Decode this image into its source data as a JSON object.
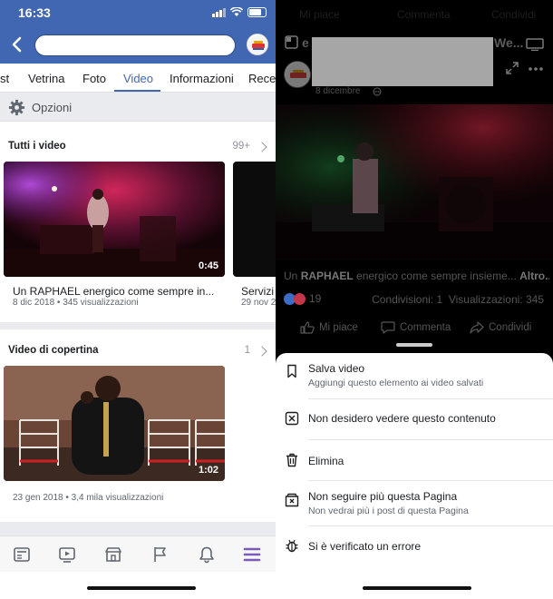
{
  "status_bar": {
    "time": "16:33"
  },
  "left": {
    "tabs": [
      "st",
      "Vetrina",
      "Foto",
      "Video",
      "Informazioni",
      "Recen"
    ],
    "active_tab": "Video",
    "options_label": "Opzioni",
    "section_all": {
      "title": "Tutti i video",
      "count": "99+"
    },
    "videos": [
      {
        "duration": "0:45",
        "title": "Un RAPHAEL energico come sempre in...",
        "meta": "8 dic 2018 • 345 visualizzazioni"
      },
      {
        "title": "Servizi",
        "meta": "29 nov 2"
      }
    ],
    "section_cover": {
      "title": "Video di copertina",
      "count": "1"
    },
    "cover_video": {
      "duration": "1:02",
      "meta": "23 gen 2018 • 3,4 mila visualizzazioni"
    },
    "bottom_nav_icons": [
      "news-feed-icon",
      "watch-icon",
      "marketplace-icon",
      "pages-icon",
      "notifications-icon",
      "menu-icon"
    ]
  },
  "right": {
    "top_actions": [
      "Mi piace",
      "Commenta",
      "Condividi"
    ],
    "page_name_prefix": "e",
    "page_name_suffix": "We...",
    "post_date": "8 dicembre",
    "caption_prefix": "Un ",
    "caption_bold": "RAPHAEL",
    "caption_rest": " energico come sempre insieme...",
    "caption_more": "Altro...",
    "reaction_count": "19",
    "shares": "Condivisioni: 1",
    "views": "Visualizzazioni: 345",
    "actions": [
      "Mi piace",
      "Commenta",
      "Condividi"
    ],
    "sheet": [
      {
        "title": "Salva video",
        "subtitle": "Aggiungi questo elemento ai video salvati",
        "icon": "bookmark-icon"
      },
      {
        "title": "Non desidero vedere questo contenuto",
        "subtitle": "",
        "icon": "hide-icon"
      },
      {
        "title": "Elimina",
        "subtitle": "",
        "icon": "trash-icon"
      },
      {
        "title": "Non seguire più questa Pagina",
        "subtitle": "Non vedrai più i post di questa Pagina",
        "icon": "unfollow-icon"
      },
      {
        "title": "Si è verificato un errore",
        "subtitle": "",
        "icon": "bug-icon"
      }
    ]
  },
  "colors": {
    "facebook_blue": "#4267b2",
    "active_nav": "#7b5bb5"
  }
}
